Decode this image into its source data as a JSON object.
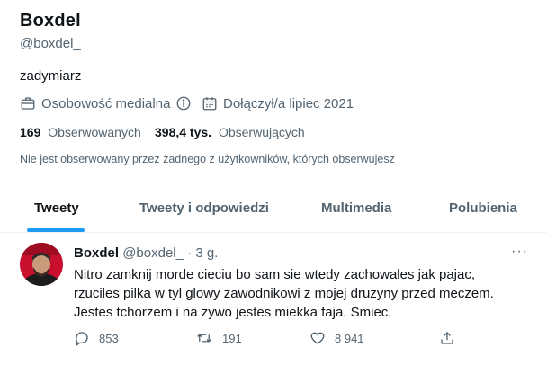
{
  "profile": {
    "name": "Boxdel",
    "handle": "@boxdel_",
    "bio": "zadymiarz",
    "category": "Osobowość medialna",
    "joined": "Dołączył/a lipiec 2021"
  },
  "stats": {
    "following_count": "169",
    "following_label": "Obserwowanych",
    "followers_count": "398,4 tys.",
    "followers_label": "Obserwujących",
    "not_followed_note": "Nie jest obserwowany przez żadnego z użytkowników, których obserwujesz"
  },
  "tabs": [
    {
      "label": "Tweety",
      "active": true
    },
    {
      "label": "Tweety i odpowiedzi",
      "active": false
    },
    {
      "label": "Multimedia",
      "active": false
    },
    {
      "label": "Polubienia",
      "active": false
    }
  ],
  "tweet": {
    "author": "Boxdel",
    "handle": "@boxdel_",
    "separator": "·",
    "time": "3 g.",
    "more": "···",
    "text": "Nitro zamknij morde cieciu bo sam sie wtedy zachowales jak pajac, rzuciles pilka w tyl glowy zawodnikowi z mojej druzyny przed meczem. Jestes tchorzem i na zywo jestes miekka faja. Smiec.",
    "replies": "853",
    "retweets": "191",
    "likes": "8 941"
  },
  "colors": {
    "accent": "#1d9bf0",
    "text": "#0f1419",
    "muted": "#536471",
    "divider": "#eff3f4"
  },
  "icons": [
    "briefcase-icon",
    "info-icon",
    "calendar-icon",
    "more-icon",
    "reply-icon",
    "retweet-icon",
    "like-icon",
    "share-icon"
  ]
}
